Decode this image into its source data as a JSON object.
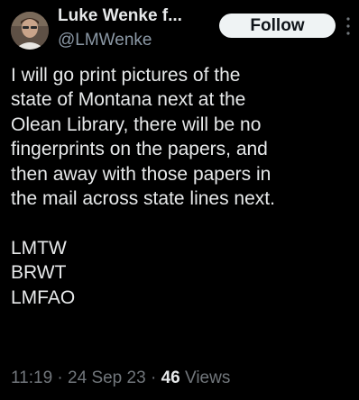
{
  "author": {
    "display_name": "Luke Wenke f...",
    "handle": "@LMWenke"
  },
  "follow_button": {
    "label": "Follow"
  },
  "more_icon": "more-vertical-icon",
  "tweet": {
    "lines": [
      "I will go print pictures of the",
      "state of Montana next at the",
      "Olean Library, there will be no",
      "fingerprints on the papers, and",
      "then away with those papers in",
      "the mail across state lines next."
    ],
    "tags": [
      "LMTW",
      "BRWT",
      "LMFAO"
    ]
  },
  "meta": {
    "time": "11:19",
    "separator": "·",
    "date": "24 Sep 23",
    "views_count": "46",
    "views_label": "Views"
  },
  "colors": {
    "background": "#000000",
    "text": "#e7e9ea",
    "secondary_text": "#8b98a5",
    "follow_bg": "#eff3f4"
  }
}
